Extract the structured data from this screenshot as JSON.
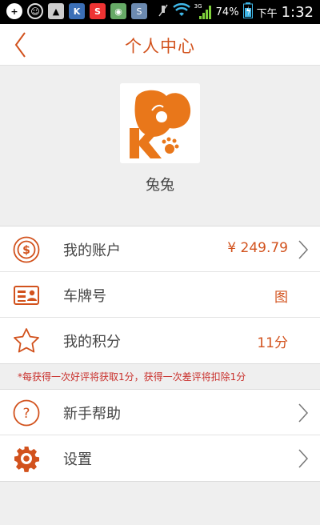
{
  "status_bar": {
    "battery": "74%",
    "ampm": "下午",
    "time": "1:32",
    "network": "3G"
  },
  "header": {
    "title": "个人中心"
  },
  "profile": {
    "username": "兔兔",
    "avatar_letter": "K"
  },
  "rows": [
    {
      "icon": "dollar-icon",
      "label": "我的账户",
      "value": "¥ 249.79"
    },
    {
      "icon": "license-plate-icon",
      "label": "车牌号",
      "value": "图"
    },
    {
      "icon": "star-icon",
      "label": "我的积分",
      "value": "11分"
    }
  ],
  "notice": "*每获得一次好评将获取1分，获得一次差评将扣除1分",
  "rows2": [
    {
      "icon": "help-icon",
      "label": "新手帮助"
    },
    {
      "icon": "gear-icon",
      "label": "设置"
    }
  ],
  "colors": {
    "accent": "#d2521d",
    "notice": "#c9302c",
    "background": "#efefef"
  }
}
